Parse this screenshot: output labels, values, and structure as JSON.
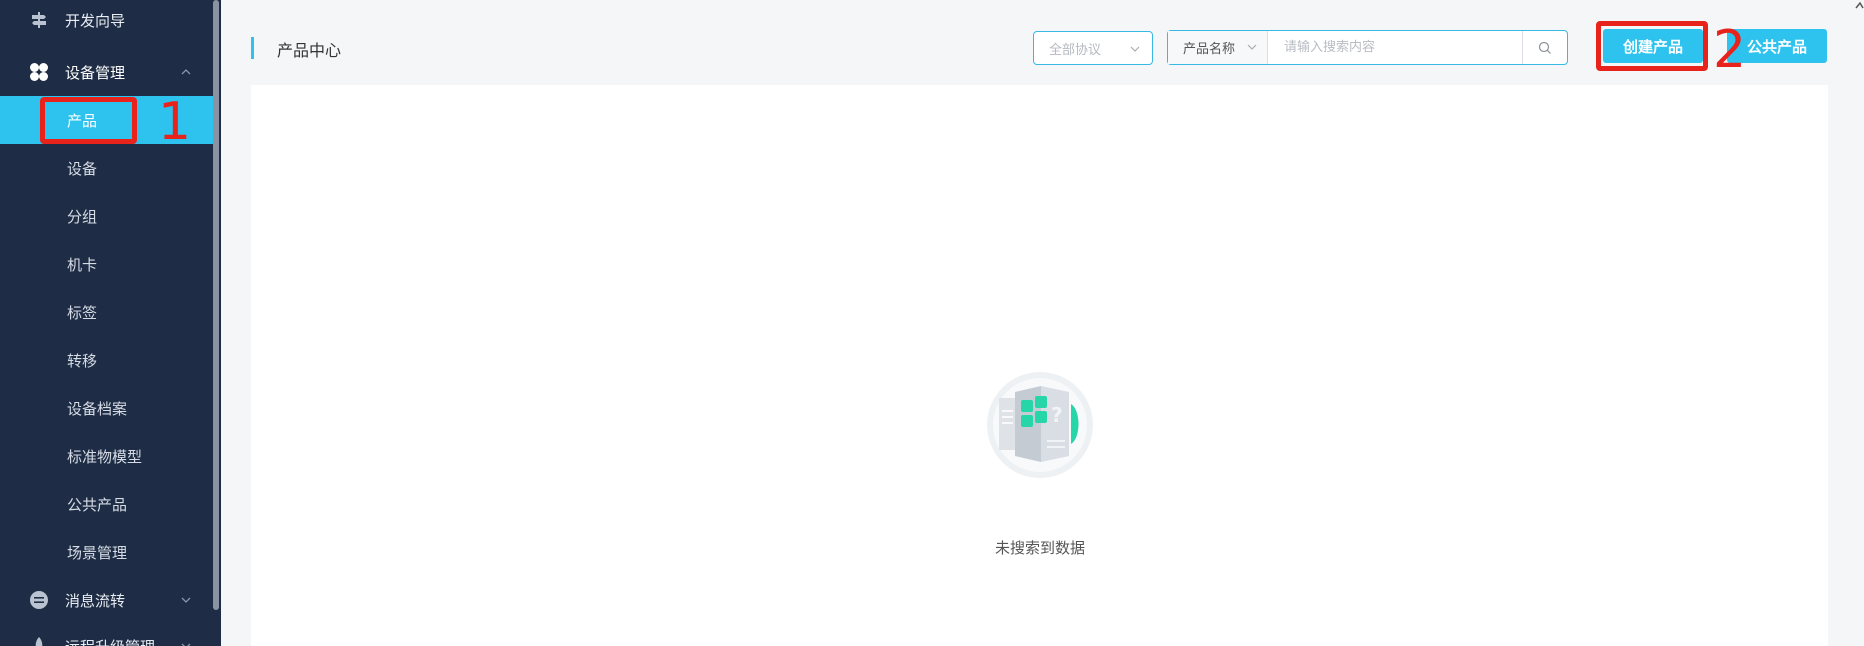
{
  "sidebar": {
    "groups": [
      {
        "label": "开发向导",
        "icon": "signpost-icon"
      },
      {
        "label": "设备管理",
        "icon": "four-petal-icon"
      },
      {
        "label": "消息流转",
        "icon": "message-flow-icon"
      },
      {
        "label": "远程升级管理",
        "icon": "rocket-icon"
      }
    ],
    "items": [
      {
        "label": "产品",
        "active": true
      },
      {
        "label": "设备"
      },
      {
        "label": "分组"
      },
      {
        "label": "机卡"
      },
      {
        "label": "标签"
      },
      {
        "label": "转移"
      },
      {
        "label": "设备档案"
      },
      {
        "label": "标准物模型"
      },
      {
        "label": "公共产品"
      },
      {
        "label": "场景管理"
      }
    ]
  },
  "header": {
    "title": "产品中心",
    "protocol_select": {
      "value": "全部协议"
    },
    "search": {
      "field": "产品名称",
      "placeholder": "请输入搜索内容",
      "icon": "search-icon"
    },
    "create_button": "创建产品",
    "public_button": "公共产品"
  },
  "annotations": [
    "1",
    "2"
  ],
  "empty_state": {
    "text": "未搜索到数据"
  },
  "colors": {
    "sidebar_bg": "#1e2d45",
    "accent": "#2ec3ee",
    "annotation_red": "#e8231c"
  }
}
